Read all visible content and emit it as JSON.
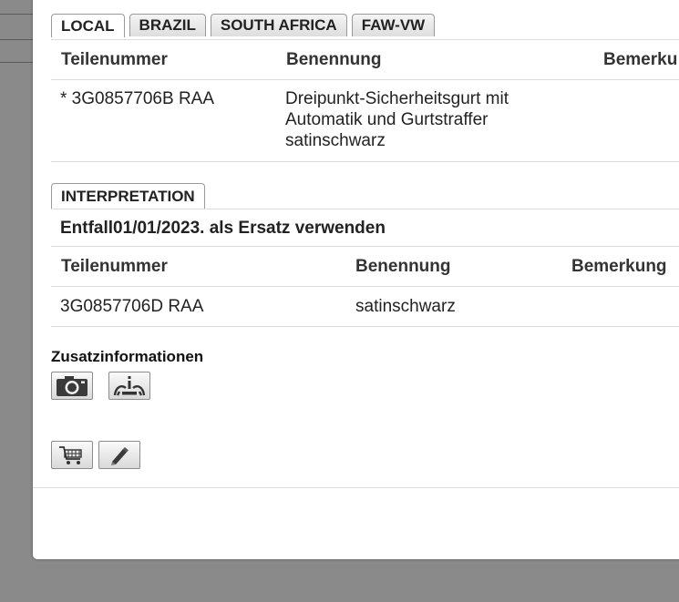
{
  "tabs": [
    "LOCAL",
    "BRAZIL",
    "SOUTH AFRICA",
    "FAW-VW"
  ],
  "parts_table": {
    "headers": [
      "Teilenummer",
      "Benennung",
      "Bemerku"
    ],
    "row": {
      "part_number": "* 3G0857706B RAA",
      "description_lines": [
        "Dreipunkt-Sicherheitsgurt mit",
        "Automatik und Gurtstraffer",
        "satinschwarz"
      ]
    }
  },
  "interpretation": {
    "tab": "INTERPRETATION",
    "note": "Entfall01/01/2023. als Ersatz verwenden",
    "headers": [
      "Teilenummer",
      "Benennung",
      "Bemerkung"
    ],
    "row": {
      "part_number": "3G0857706D RAA",
      "description": "satinschwarz"
    }
  },
  "extra_info": {
    "title": "Zusatzinformationen"
  },
  "icons": {
    "photo": "camera-icon",
    "installation": "installation-location-icon",
    "cart": "shopping-cart-icon",
    "edit": "pencil-icon"
  }
}
